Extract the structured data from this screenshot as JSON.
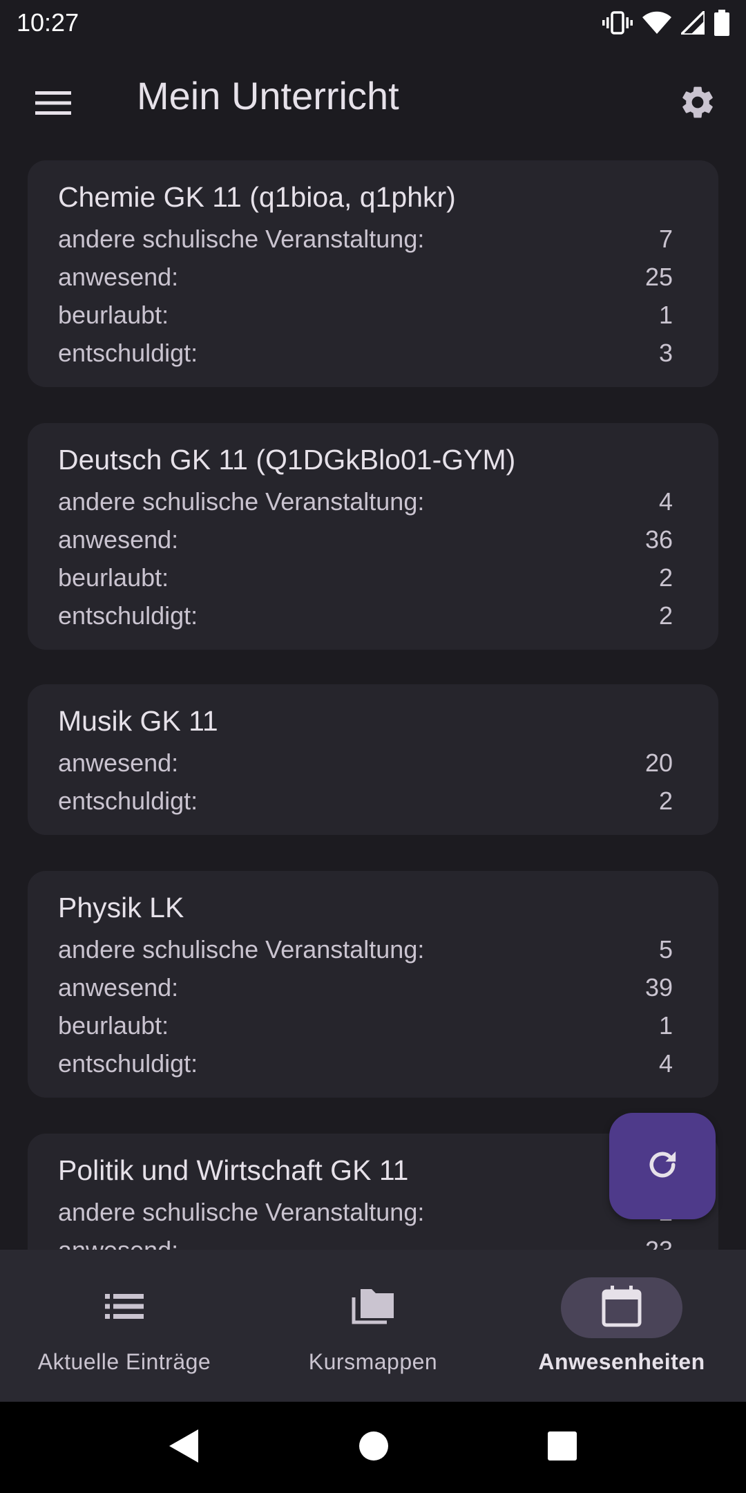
{
  "status_bar": {
    "time": "10:27",
    "icons": [
      "vibrate-icon",
      "wifi-icon",
      "signal-icon",
      "battery-icon"
    ]
  },
  "app_bar": {
    "title": "Mein Unterricht",
    "menu_icon": "menu-icon",
    "settings_icon": "gear-icon"
  },
  "courses": [
    {
      "title": "Chemie GK 11 (q1bioa, q1phkr)",
      "rows": [
        {
          "label": "andere schulische Veranstaltung:",
          "value": "7"
        },
        {
          "label": "anwesend:",
          "value": "25"
        },
        {
          "label": "beurlaubt:",
          "value": "1"
        },
        {
          "label": "entschuldigt:",
          "value": "3"
        }
      ]
    },
    {
      "title": "Deutsch GK 11 (Q1DGkBlo01-GYM)",
      "rows": [
        {
          "label": "andere schulische Veranstaltung:",
          "value": "4"
        },
        {
          "label": "anwesend:",
          "value": "36"
        },
        {
          "label": "beurlaubt:",
          "value": "2"
        },
        {
          "label": "entschuldigt:",
          "value": "2"
        }
      ]
    },
    {
      "title": "Musik GK 11",
      "rows": [
        {
          "label": "anwesend:",
          "value": "20"
        },
        {
          "label": "entschuldigt:",
          "value": "2"
        }
      ]
    },
    {
      "title": "Physik LK",
      "rows": [
        {
          "label": "andere schulische Veranstaltung:",
          "value": "5"
        },
        {
          "label": "anwesend:",
          "value": "39"
        },
        {
          "label": "beurlaubt:",
          "value": "1"
        },
        {
          "label": "entschuldigt:",
          "value": "4"
        }
      ]
    },
    {
      "title": "Politik und Wirtschaft GK 11",
      "rows": [
        {
          "label": "andere schulische Veranstaltung:",
          "value": "2"
        },
        {
          "label": "anwesend:",
          "value": "23"
        }
      ]
    }
  ],
  "fab": {
    "icon": "refresh-icon"
  },
  "bottom_nav": {
    "items": [
      {
        "label": "Aktuelle Einträge",
        "icon": "list-icon",
        "active": false
      },
      {
        "label": "Kursmappen",
        "icon": "folders-icon",
        "active": false
      },
      {
        "label": "Anwesenheiten",
        "icon": "calendar-icon",
        "active": true
      }
    ]
  },
  "system_nav": {
    "icons": [
      "back-icon",
      "home-icon",
      "recents-icon"
    ]
  },
  "colors": {
    "background": "#1c1b20",
    "card": "#26252c",
    "fab": "#4e3a8a",
    "nav_active_pill": "#4a4458"
  }
}
